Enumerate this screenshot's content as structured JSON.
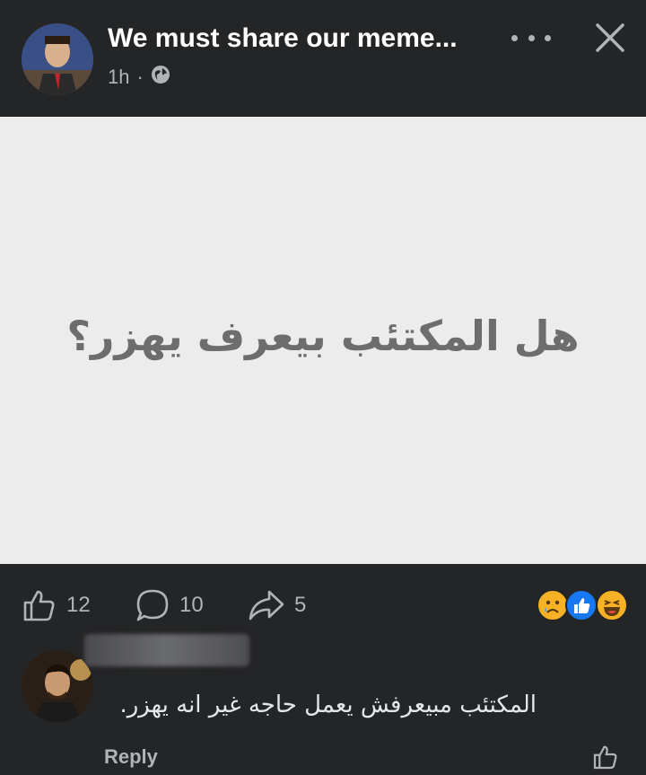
{
  "post": {
    "group_title": "We must share our meme...",
    "time": "1h",
    "separator": "·",
    "privacy_icon": "globe-icon",
    "meme_text": "هل المكتئب بيعرف يهزر؟"
  },
  "header_icons": {
    "more": "more-dots-icon",
    "close": "close-icon"
  },
  "stats": {
    "likes": "12",
    "comments": "10",
    "shares": "5",
    "reactions": [
      "sad-reaction",
      "like-reaction",
      "haha-reaction"
    ]
  },
  "comment": {
    "text": "المكتئب مبيعرفش يعمل حاجه غير انه يهزر.",
    "reply_label": "Reply"
  },
  "colors": {
    "background": "#242526",
    "post_bg": "#ececec",
    "text_muted": "#b0b3b8",
    "like_blue": "#1877f2"
  }
}
